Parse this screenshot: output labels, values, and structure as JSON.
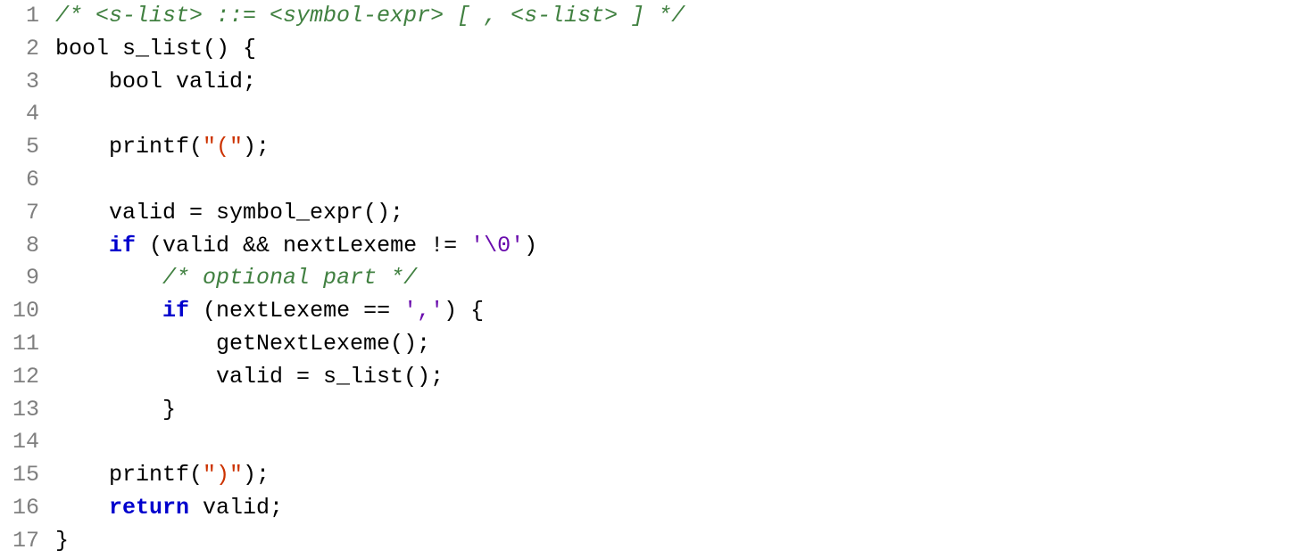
{
  "code": {
    "lines": [
      {
        "n": "1",
        "tokens": [
          {
            "c": "cm",
            "t": "/* <s-list> ::= <symbol-expr> [ , <s-list> ] */"
          }
        ]
      },
      {
        "n": "2",
        "tokens": [
          {
            "c": "ty",
            "t": "bool"
          },
          {
            "c": "",
            "t": " s_list() {"
          }
        ]
      },
      {
        "n": "3",
        "tokens": [
          {
            "c": "",
            "t": "    "
          },
          {
            "c": "ty",
            "t": "bool"
          },
          {
            "c": "",
            "t": " valid;"
          }
        ]
      },
      {
        "n": "4",
        "tokens": [
          {
            "c": "",
            "t": ""
          }
        ]
      },
      {
        "n": "5",
        "tokens": [
          {
            "c": "",
            "t": "    printf("
          },
          {
            "c": "str",
            "t": "\"(\""
          },
          {
            "c": "",
            "t": ");"
          }
        ]
      },
      {
        "n": "6",
        "tokens": [
          {
            "c": "",
            "t": ""
          }
        ]
      },
      {
        "n": "7",
        "tokens": [
          {
            "c": "",
            "t": "    valid = symbol_expr();"
          }
        ]
      },
      {
        "n": "8",
        "tokens": [
          {
            "c": "",
            "t": "    "
          },
          {
            "c": "kw",
            "t": "if"
          },
          {
            "c": "",
            "t": " (valid && nextLexeme != "
          },
          {
            "c": "ch",
            "t": "'\\0'"
          },
          {
            "c": "",
            "t": ")"
          }
        ]
      },
      {
        "n": "9",
        "tokens": [
          {
            "c": "",
            "t": "        "
          },
          {
            "c": "cm",
            "t": "/* optional part */"
          }
        ]
      },
      {
        "n": "10",
        "tokens": [
          {
            "c": "",
            "t": "        "
          },
          {
            "c": "kw",
            "t": "if"
          },
          {
            "c": "",
            "t": " (nextLexeme == "
          },
          {
            "c": "ch",
            "t": "','"
          },
          {
            "c": "",
            "t": ") {"
          }
        ]
      },
      {
        "n": "11",
        "tokens": [
          {
            "c": "",
            "t": "            getNextLexeme();"
          }
        ]
      },
      {
        "n": "12",
        "tokens": [
          {
            "c": "",
            "t": "            valid = s_list();"
          }
        ]
      },
      {
        "n": "13",
        "tokens": [
          {
            "c": "",
            "t": "        }"
          }
        ]
      },
      {
        "n": "14",
        "tokens": [
          {
            "c": "",
            "t": ""
          }
        ]
      },
      {
        "n": "15",
        "tokens": [
          {
            "c": "",
            "t": "    printf("
          },
          {
            "c": "str",
            "t": "\")\""
          },
          {
            "c": "",
            "t": ");"
          }
        ]
      },
      {
        "n": "16",
        "tokens": [
          {
            "c": "",
            "t": "    "
          },
          {
            "c": "kw",
            "t": "return"
          },
          {
            "c": "",
            "t": " valid;"
          }
        ]
      },
      {
        "n": "17",
        "tokens": [
          {
            "c": "",
            "t": "}"
          }
        ]
      }
    ]
  }
}
